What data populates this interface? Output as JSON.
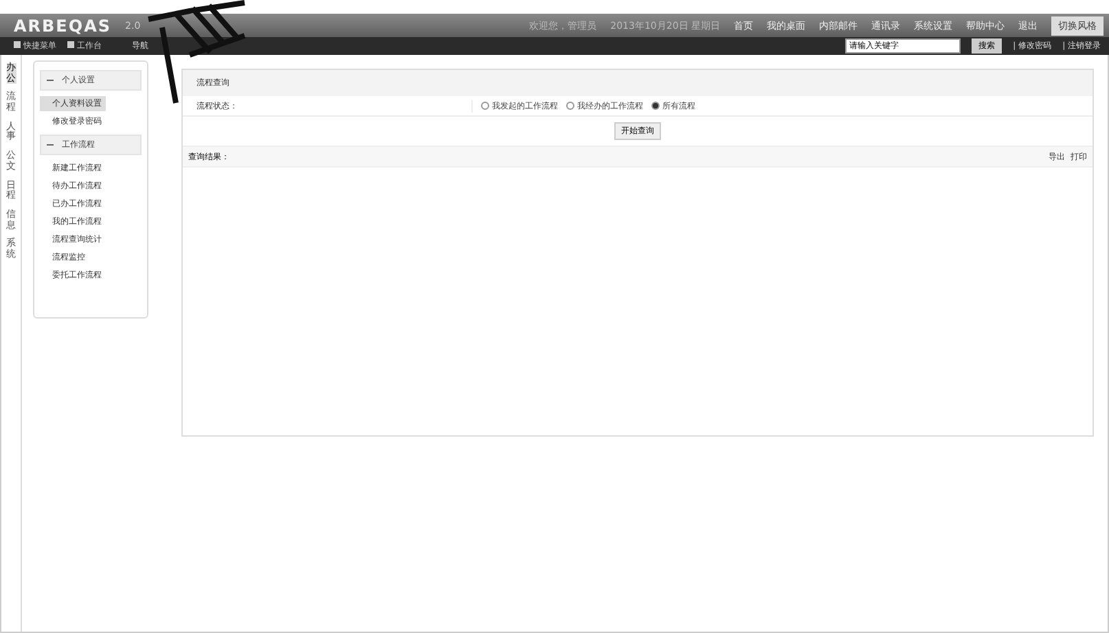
{
  "header": {
    "logo": "ARBEQAS",
    "version": "2.0",
    "nav": [
      {
        "label": "欢迎您，管理员",
        "kind": "info"
      },
      {
        "label": "2013年10月20日 星期日",
        "kind": "info"
      },
      {
        "label": "首页",
        "kind": "link"
      },
      {
        "label": "我的桌面",
        "kind": "link"
      },
      {
        "label": "内部邮件",
        "kind": "link"
      },
      {
        "label": "通讯录",
        "kind": "link"
      },
      {
        "label": "系统设置",
        "kind": "link"
      },
      {
        "label": "帮助中心",
        "kind": "link"
      },
      {
        "label": "退出",
        "kind": "link"
      }
    ],
    "style_button": "切换风格"
  },
  "toolbar": {
    "shortcuts": [
      "快捷菜单",
      "工作台"
    ],
    "crumb": "导航",
    "search": {
      "value": "请输入关键字"
    },
    "search_button": "搜索",
    "links": [
      "| 修改密码",
      "| 注销登录"
    ]
  },
  "side_tabs": [
    {
      "label": "办公",
      "selected": true
    },
    {
      "label": "流程",
      "selected": false
    },
    {
      "label": "人事",
      "selected": false
    },
    {
      "label": "公文",
      "selected": false
    },
    {
      "label": "日程",
      "selected": false
    },
    {
      "label": "信息",
      "selected": false
    },
    {
      "label": "系统",
      "selected": false
    }
  ],
  "sidebar": {
    "sections": [
      {
        "title": "个人设置",
        "expanded": true,
        "items": [
          {
            "label": "个人资料设置",
            "selected": true
          },
          {
            "label": "修改登录密码",
            "selected": false
          }
        ]
      },
      {
        "title": "工作流程",
        "expanded": true,
        "items": [
          {
            "label": "新建工作流程",
            "selected": false
          },
          {
            "label": "待办工作流程",
            "selected": false
          },
          {
            "label": "已办工作流程",
            "selected": false
          },
          {
            "label": "我的工作流程",
            "selected": false
          },
          {
            "label": "流程查询统计",
            "selected": false
          },
          {
            "label": "流程监控",
            "selected": false
          },
          {
            "label": "委托工作流程",
            "selected": false
          }
        ]
      }
    ]
  },
  "panel": {
    "title": "流程查询",
    "filter_label": "流程状态：",
    "options": [
      {
        "label": "我发起的工作流程",
        "selected": false
      },
      {
        "label": "我经办的工作流程",
        "selected": false
      },
      {
        "label": "所有流程",
        "selected": true
      }
    ],
    "query_button": "开始查询",
    "result_label": "查询结果：",
    "actions": [
      "导出",
      "打印"
    ]
  }
}
